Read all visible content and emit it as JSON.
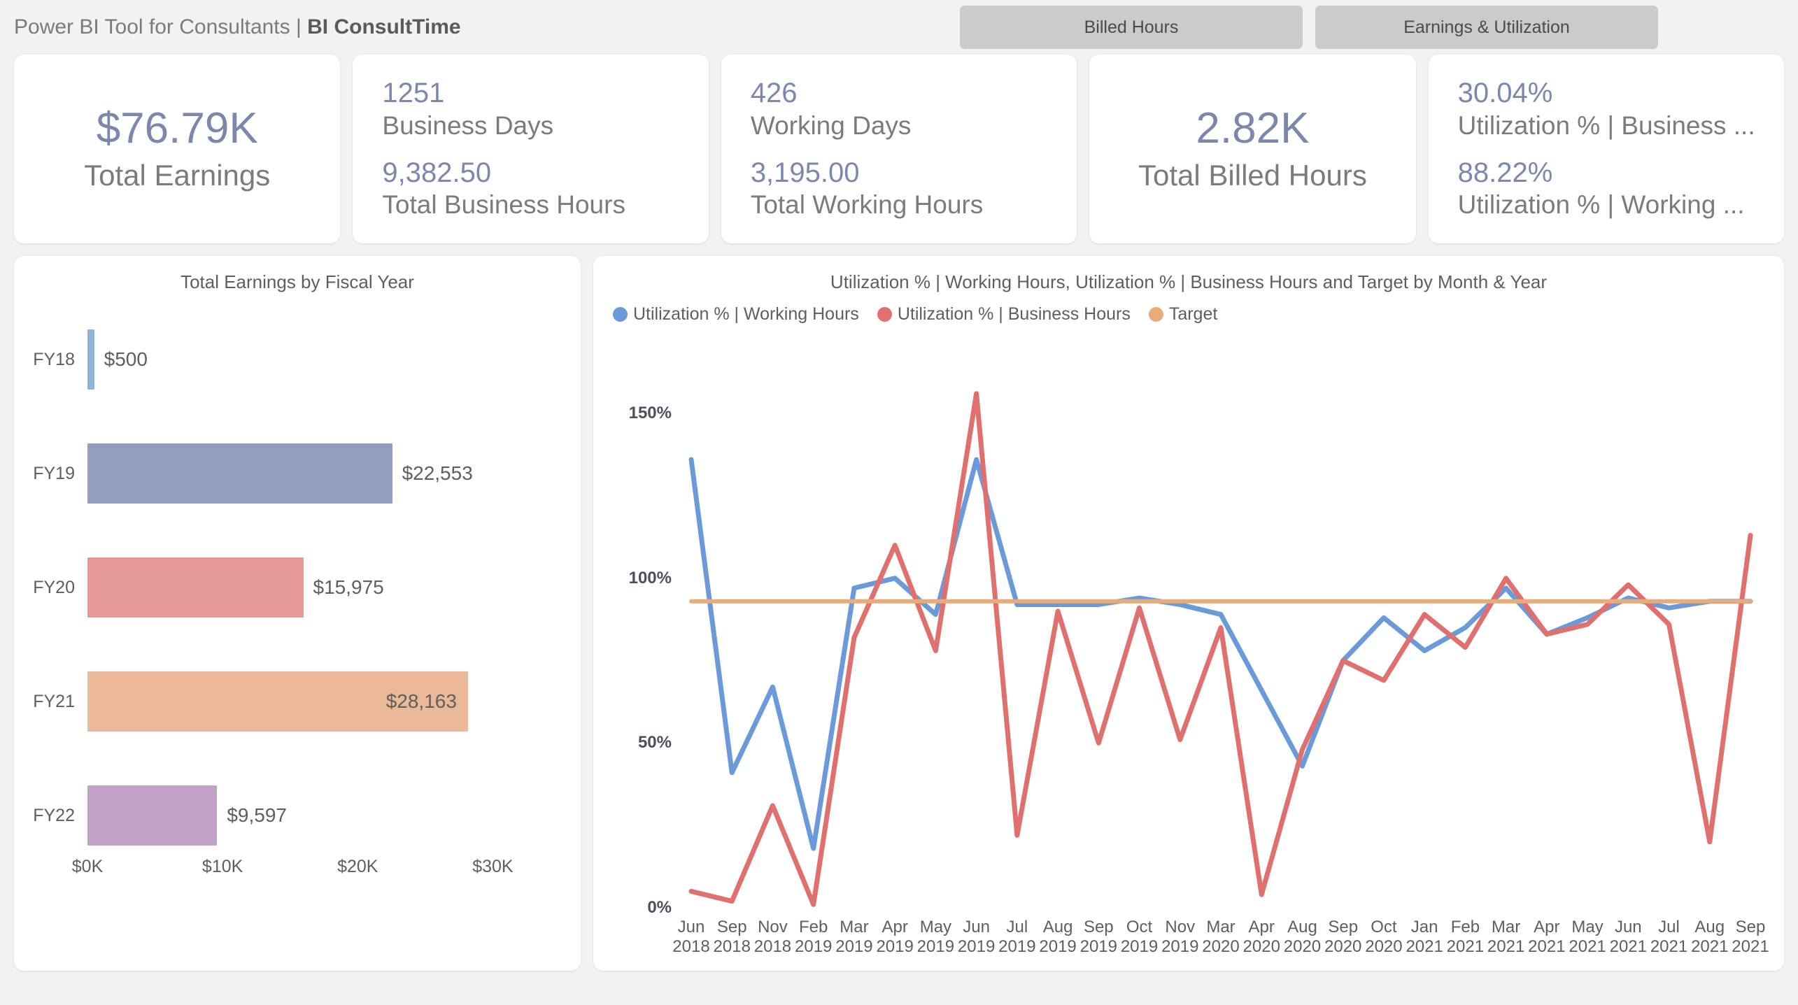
{
  "header": {
    "title_prefix": "Power BI Tool for Consultants",
    "title_separator": " | ",
    "title_bold": "BI ConsultTime",
    "nav": [
      {
        "label": "Billed Hours"
      },
      {
        "label": "Earnings & Utilization"
      }
    ]
  },
  "kpis": [
    {
      "value": "$76.79K",
      "label": "Total Earnings",
      "layout": "center"
    },
    {
      "value1": "1251",
      "label1": "Business Days",
      "value2": "9,382.50",
      "label2": "Total Business Hours",
      "layout": "stack"
    },
    {
      "value1": "426",
      "label1": "Working Days",
      "value2": "3,195.00",
      "label2": "Total Working Hours",
      "layout": "stack"
    },
    {
      "value": "2.82K",
      "label": "Total Billed Hours",
      "layout": "center"
    },
    {
      "value1": "30.04%",
      "label1": "Utilization % | Business ...",
      "value2": "88.22%",
      "label2": "Utilization % | Working ...",
      "layout": "stack"
    }
  ],
  "colors": {
    "value_blue": "#7b87ad",
    "label_gray": "#7b7b7b",
    "series_working": "#6a9ad9",
    "series_business": "#e0706e",
    "series_target": "#e9ab78",
    "bar_fy18": "#8fb4dc",
    "bar_fy19": "#949ebc",
    "bar_fy20": "#e59a98",
    "bar_fy21": "#eab99a",
    "bar_fy22": "#c3a2ca",
    "page_bg": "#f2f2f2",
    "card_bg": "#ffffff",
    "nav_bg": "#cbcbcb"
  },
  "chart_data": [
    {
      "type": "bar",
      "title": "Total Earnings by Fiscal Year",
      "orientation": "horizontal",
      "xlabel": "",
      "ylabel": "",
      "categories": [
        "FY18",
        "FY19",
        "FY20",
        "FY21",
        "FY22"
      ],
      "values": [
        500,
        22553,
        15975,
        28163,
        9597
      ],
      "value_labels": [
        "$500",
        "$22,553",
        "$15,975",
        "$28,163",
        "$9,597"
      ],
      "bar_colors": [
        "#8fb4dc",
        "#949ebc",
        "#e59a98",
        "#eab99a",
        "#c3a2ca"
      ],
      "label_inside": [
        false,
        false,
        false,
        true,
        false
      ],
      "xlim": [
        0,
        33500
      ],
      "xticks": [
        0,
        10000,
        20000,
        30000
      ],
      "xtick_labels": [
        "$0K",
        "$10K",
        "$20K",
        "$30K"
      ],
      "grid": false
    },
    {
      "type": "line",
      "title": "Utilization % | Working Hours, Utilization %  | Business Hours and Target by Month & Year",
      "xlabel": "",
      "ylabel": "",
      "ylim": [
        0,
        160
      ],
      "yticks": [
        0,
        50,
        100,
        150
      ],
      "ytick_labels": [
        "0%",
        "50%",
        "100%",
        "150%"
      ],
      "grid": false,
      "legend_position": "top-left",
      "categories": [
        "Jun\n2018",
        "Sep\n2018",
        "Nov\n2018",
        "Feb\n2019",
        "Mar\n2019",
        "Apr\n2019",
        "May\n2019",
        "Jun\n2019",
        "Jul\n2019",
        "Aug\n2019",
        "Sep\n2019",
        "Oct\n2019",
        "Nov\n2019",
        "Mar\n2020",
        "Apr\n2020",
        "Aug\n2020",
        "Sep\n2020",
        "Oct\n2020",
        "Jan\n2021",
        "Feb\n2021",
        "Mar\n2021",
        "Apr\n2021",
        "May\n2021",
        "Jun\n2021",
        "Jul\n2021",
        "Aug\n2021",
        "Sep\n2021"
      ],
      "series": [
        {
          "name": "Utilization % | Working Hours",
          "color": "#6a9ad9",
          "values": [
            136,
            41,
            67,
            18,
            97,
            100,
            89,
            136,
            92,
            92,
            92,
            94,
            92,
            89,
            66,
            43,
            75,
            88,
            78,
            85,
            97,
            83,
            88,
            94,
            91,
            93,
            93
          ]
        },
        {
          "name": "Utilization %  | Business Hours",
          "color": "#e0706e",
          "values": [
            5,
            2,
            31,
            1,
            82,
            110,
            78,
            156,
            22,
            90,
            50,
            91,
            51,
            85,
            4,
            48,
            75,
            69,
            89,
            79,
            100,
            83,
            86,
            98,
            86,
            20,
            113
          ]
        },
        {
          "name": "Target",
          "color": "#e9ab78",
          "constant": 93,
          "values": [
            93,
            93,
            93,
            93,
            93,
            93,
            93,
            93,
            93,
            93,
            93,
            93,
            93,
            93,
            93,
            93,
            93,
            93,
            93,
            93,
            93,
            93,
            93,
            93,
            93,
            93,
            93
          ]
        }
      ]
    }
  ]
}
